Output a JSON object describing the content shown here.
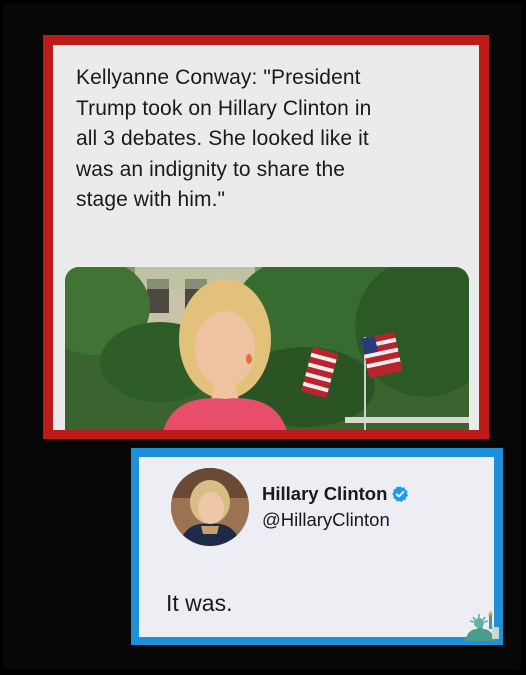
{
  "quote_card": {
    "lines": [
      "Kellyanne Conway: \"President",
      "Trump took on Hillary Clinton in",
      "all 3 debates. She looked like it",
      "was an indignity to share the",
      "stage with him.\""
    ],
    "border_color": "#bd1a1a",
    "photo_icon": "photo-of-speaker-outdoors-with-flags"
  },
  "tweet_card": {
    "display_name": "Hillary Clinton",
    "handle": "@HillaryClinton",
    "text": "It was.",
    "verified": true,
    "border_color": "#1f8fd8",
    "accent": "#1d9bf0"
  },
  "watermark_icon": "statue-of-liberty-icon"
}
